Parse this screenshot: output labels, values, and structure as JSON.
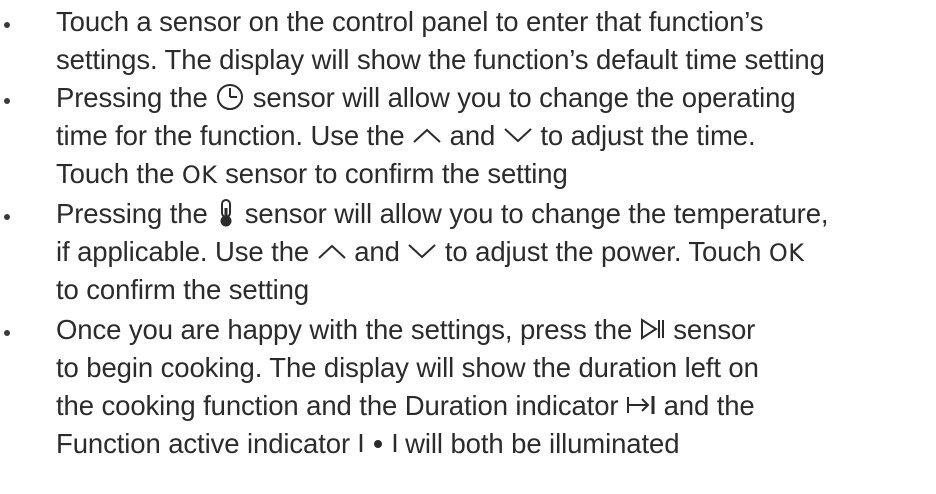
{
  "bullets": [
    {
      "lines": [
        "Touch a sensor on the control panel to enter that function’s",
        "settings. The display will show the function’s default time setting"
      ]
    },
    {
      "l1_a": "Pressing the",
      "l1_icon": "clock-icon",
      "l1_b": "sensor will allow you to change the operating",
      "l2_a": "time for the function. Use the",
      "l2_icon1": "chevron-up-icon",
      "l2_b": "and",
      "l2_icon2": "chevron-down-icon",
      "l2_c": "to adjust the time.",
      "l3_a": "Touch the",
      "l3_ok": "OK",
      "l3_b": "sensor to confirm the setting"
    },
    {
      "l1_a": "Pressing the",
      "l1_icon": "thermometer-icon",
      "l1_b": "sensor will allow you to change the temperature,",
      "l2_a": "if applicable. Use the",
      "l2_icon1": "chevron-up-icon",
      "l2_b": "and",
      "l2_icon2": "chevron-down-icon",
      "l2_c": "to adjust the power. Touch",
      "l2_ok": "OK",
      "l3": "to confirm the setting"
    },
    {
      "l1_a": "Once you are happy with the settings, press the",
      "l1_icon": "play-pause-icon",
      "l1_b": "sensor",
      "l2": "to begin cooking. The display will show the duration left on",
      "l3_a": "the cooking function and the Duration indicator",
      "l3_icon": "duration-indicator-icon",
      "l3_b": "and the",
      "l4_a": "Function active indicator",
      "l4_icon": "function-active-indicator-icon",
      "l4_b": "will both be illuminated"
    }
  ],
  "colors": {
    "text": "#2b2b2b"
  }
}
